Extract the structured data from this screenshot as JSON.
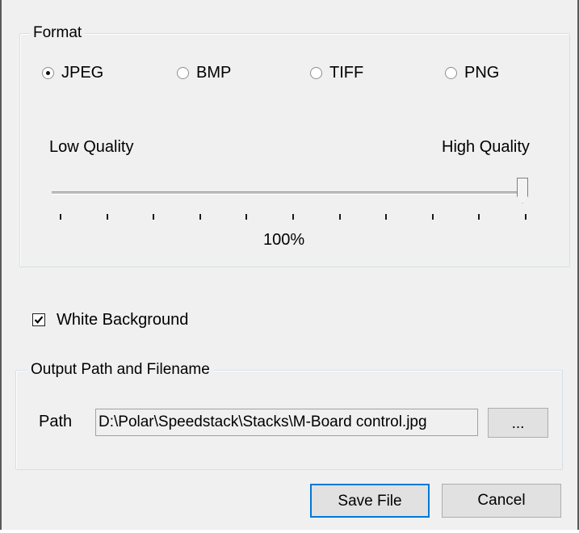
{
  "format_group": {
    "title": "Format",
    "options": [
      {
        "label": "JPEG",
        "checked": true
      },
      {
        "label": "BMP",
        "checked": false
      },
      {
        "label": "TIFF",
        "checked": false
      },
      {
        "label": "PNG",
        "checked": false
      }
    ],
    "quality": {
      "low_label": "Low Quality",
      "high_label": "High Quality",
      "value_label": "100%",
      "value_percent": 100
    }
  },
  "white_background": {
    "label": "White Background",
    "checked": true
  },
  "output_group": {
    "title": "Output Path and Filename",
    "path_label": "Path",
    "path_value": "D:\\Polar\\Speedstack\\Stacks\\M-Board control.jpg",
    "browse_label": "..."
  },
  "buttons": {
    "save": "Save File",
    "cancel": "Cancel"
  },
  "colors": {
    "default_button_border": "#0078d7",
    "group_border": "#d5dfe5"
  }
}
